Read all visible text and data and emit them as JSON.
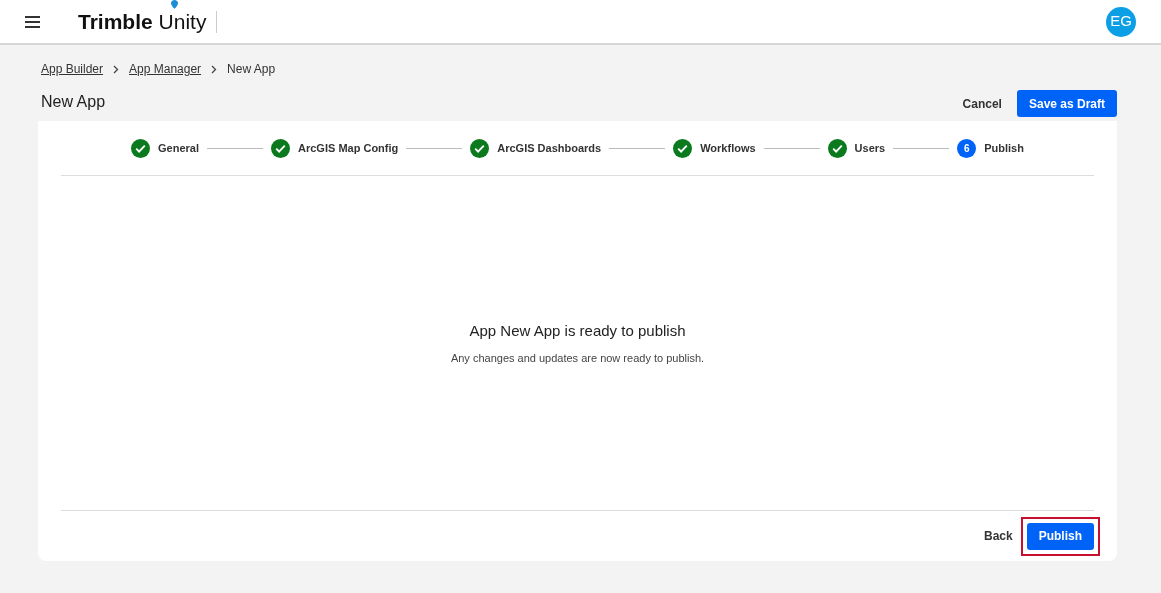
{
  "header": {
    "logo_bold": "Trimble",
    "logo_light": "Unity",
    "avatar": "EG"
  },
  "breadcrumb": [
    {
      "label": "App Builder",
      "link": true
    },
    {
      "label": "App Manager",
      "link": true
    },
    {
      "label": "New App",
      "link": false
    }
  ],
  "page_title": "New App",
  "actions": {
    "cancel": "Cancel",
    "save": "Save as Draft"
  },
  "steps": [
    {
      "label": "General",
      "completed": true
    },
    {
      "label": "ArcGIS Map Config",
      "completed": true
    },
    {
      "label": "ArcGIS Dashboards",
      "completed": true
    },
    {
      "label": "Workflows",
      "completed": true
    },
    {
      "label": "Users",
      "completed": true
    },
    {
      "label": "Publish",
      "completed": false,
      "number": "6"
    }
  ],
  "message": {
    "title": "App New App is ready to publish",
    "subtitle": "Any changes and updates are now ready to publish."
  },
  "footer": {
    "back": "Back",
    "publish": "Publish",
    "publish_highlighted": true
  }
}
